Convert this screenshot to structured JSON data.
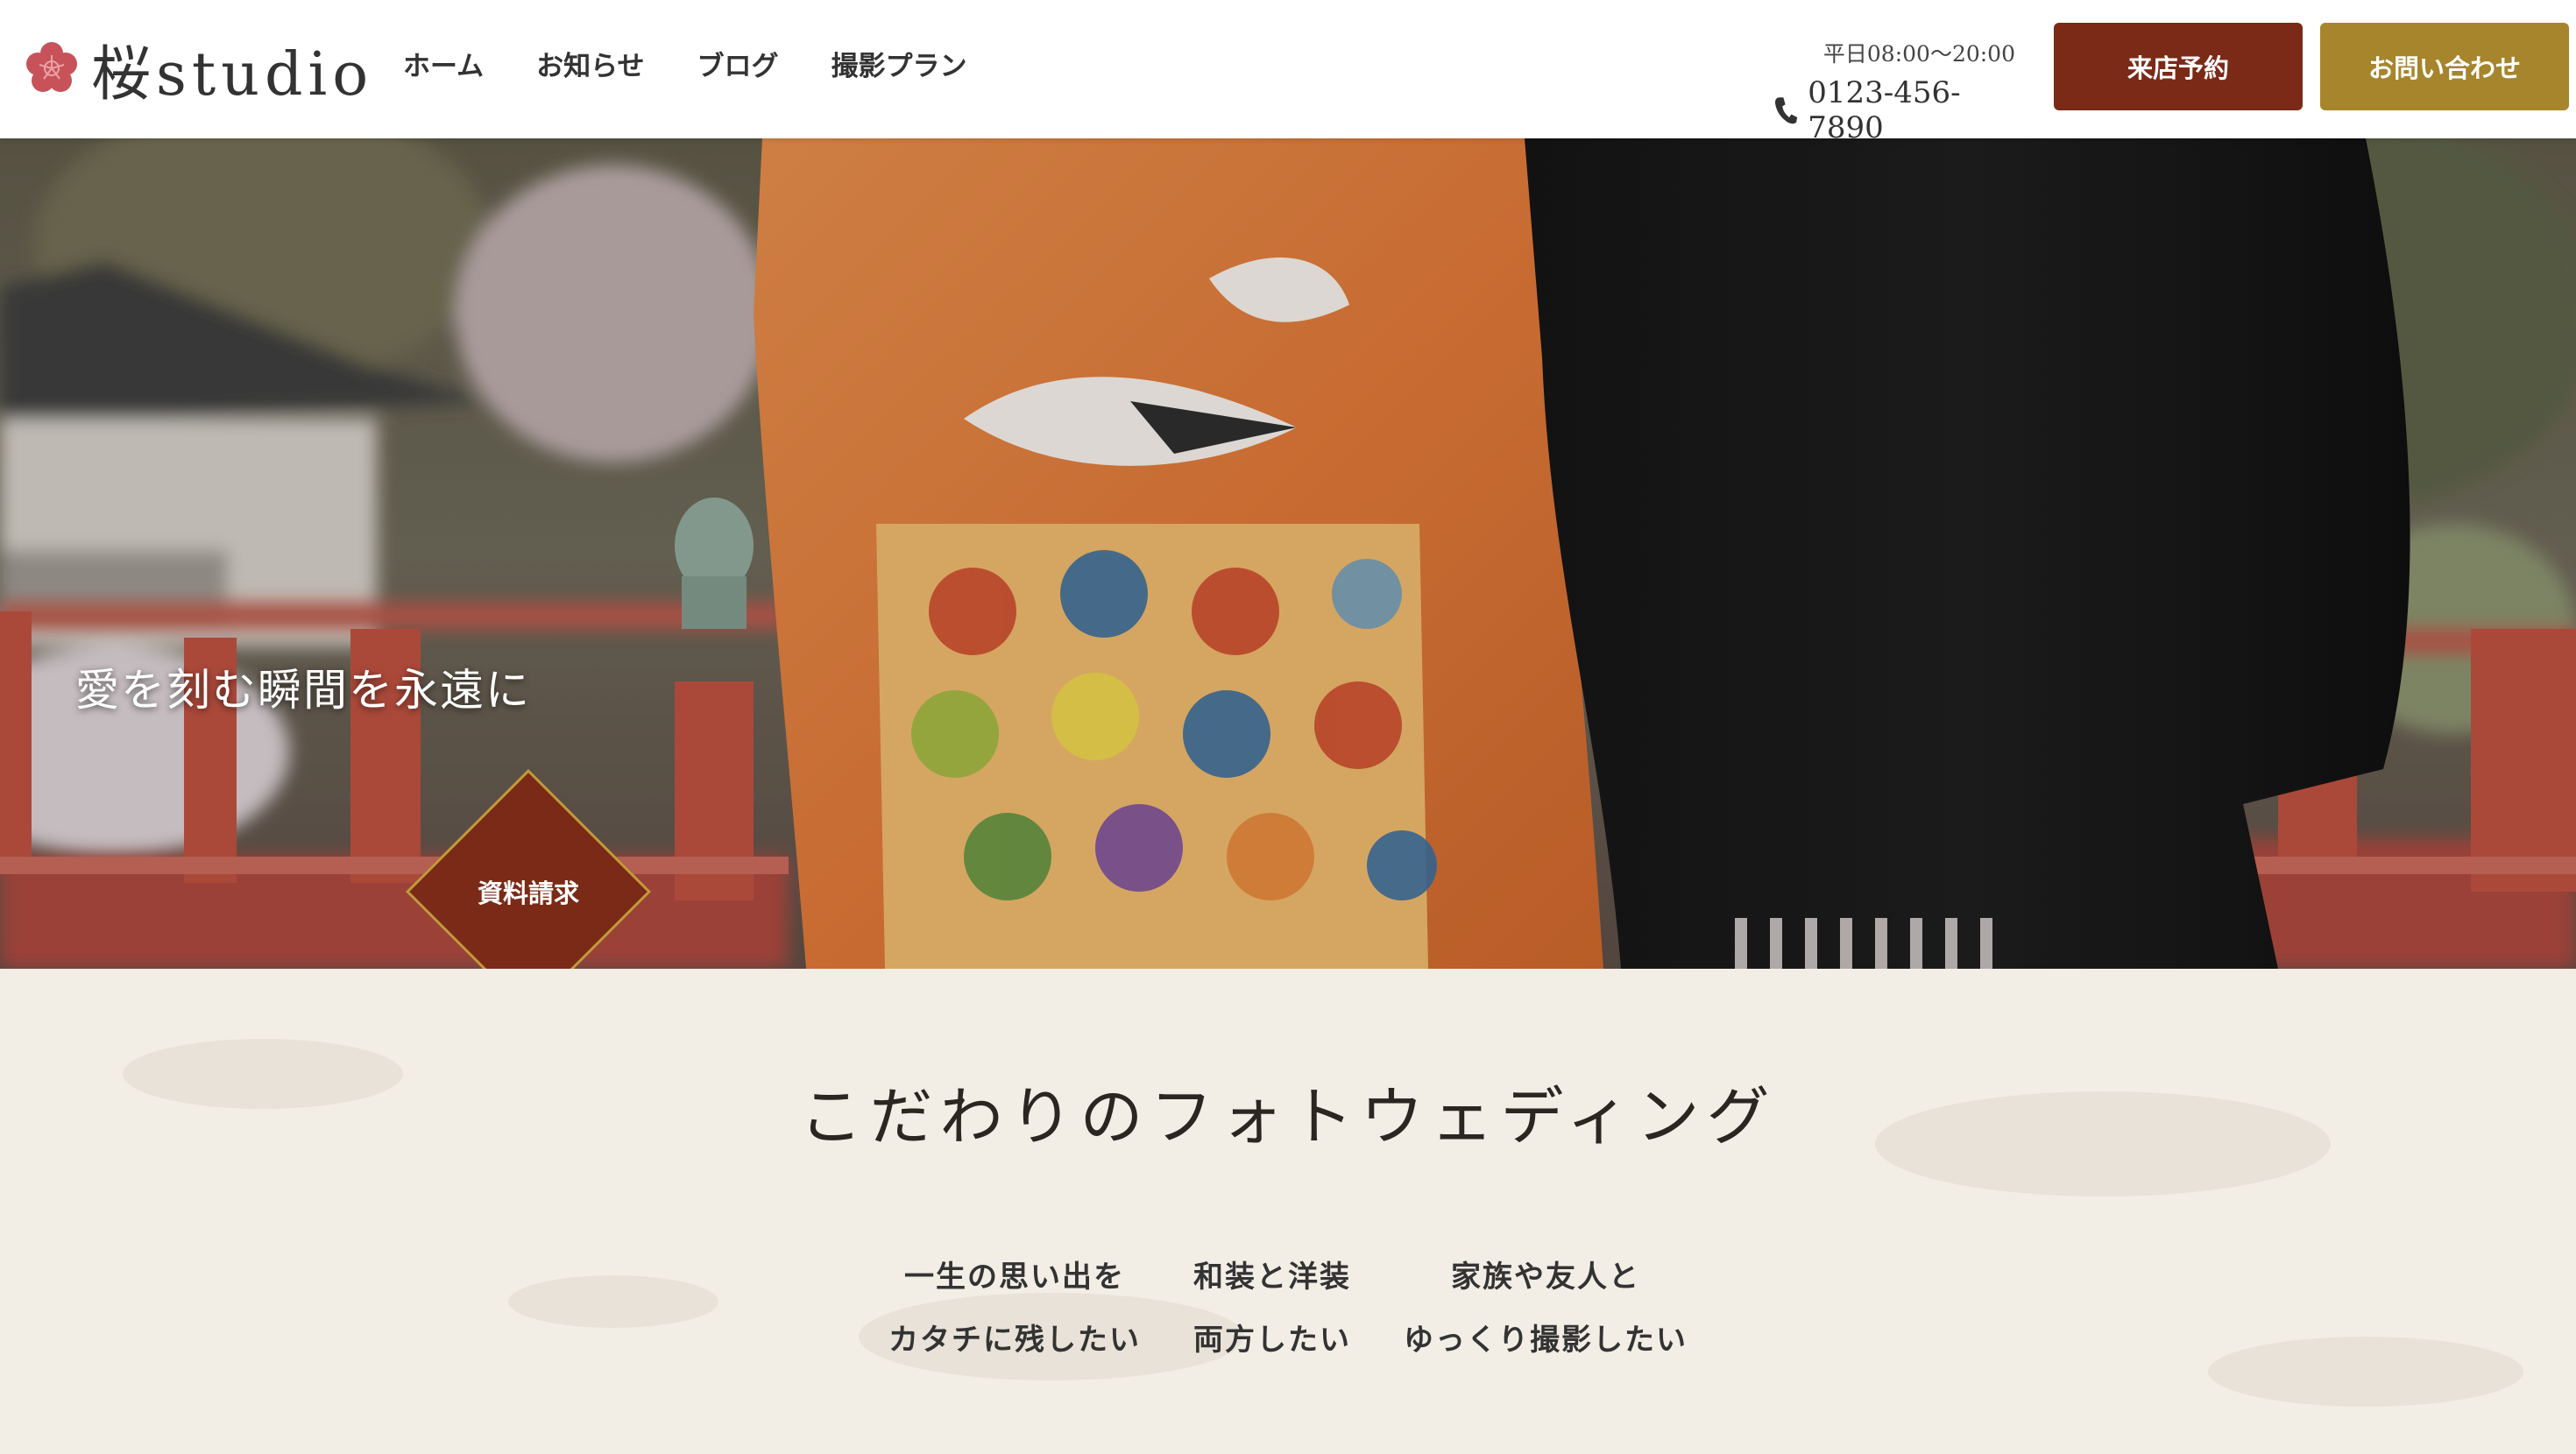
{
  "header": {
    "logo_text": "桜studio",
    "nav": [
      "ホーム",
      "お知らせ",
      "ブログ",
      "撮影プラン"
    ],
    "hours": "平日08:00〜20:00",
    "phone": "0123-456-7890",
    "reserve_label": "来店予約",
    "contact_label": "お問い合わせ"
  },
  "hero": {
    "catchphrase": "愛を刻む瞬間を永遠に",
    "request_label": "資料請求"
  },
  "features_section": {
    "title": "こだわりのフォトウェディング",
    "items": [
      {
        "line1": "一生の思い出を",
        "line2": "カタチに残したい"
      },
      {
        "line1": "和装と洋装",
        "line2": "両方したい"
      },
      {
        "line1": "家族や友人と",
        "line2": "ゆっくり撮影したい"
      }
    ]
  },
  "colors": {
    "brand_dark_red": "#7a2a17",
    "brand_gold": "#a6852c",
    "logo_pink": "#c8525a",
    "section_bg": "#f2eee6"
  },
  "icons": {
    "logo": "plum-blossom-icon",
    "phone": "phone-icon"
  }
}
